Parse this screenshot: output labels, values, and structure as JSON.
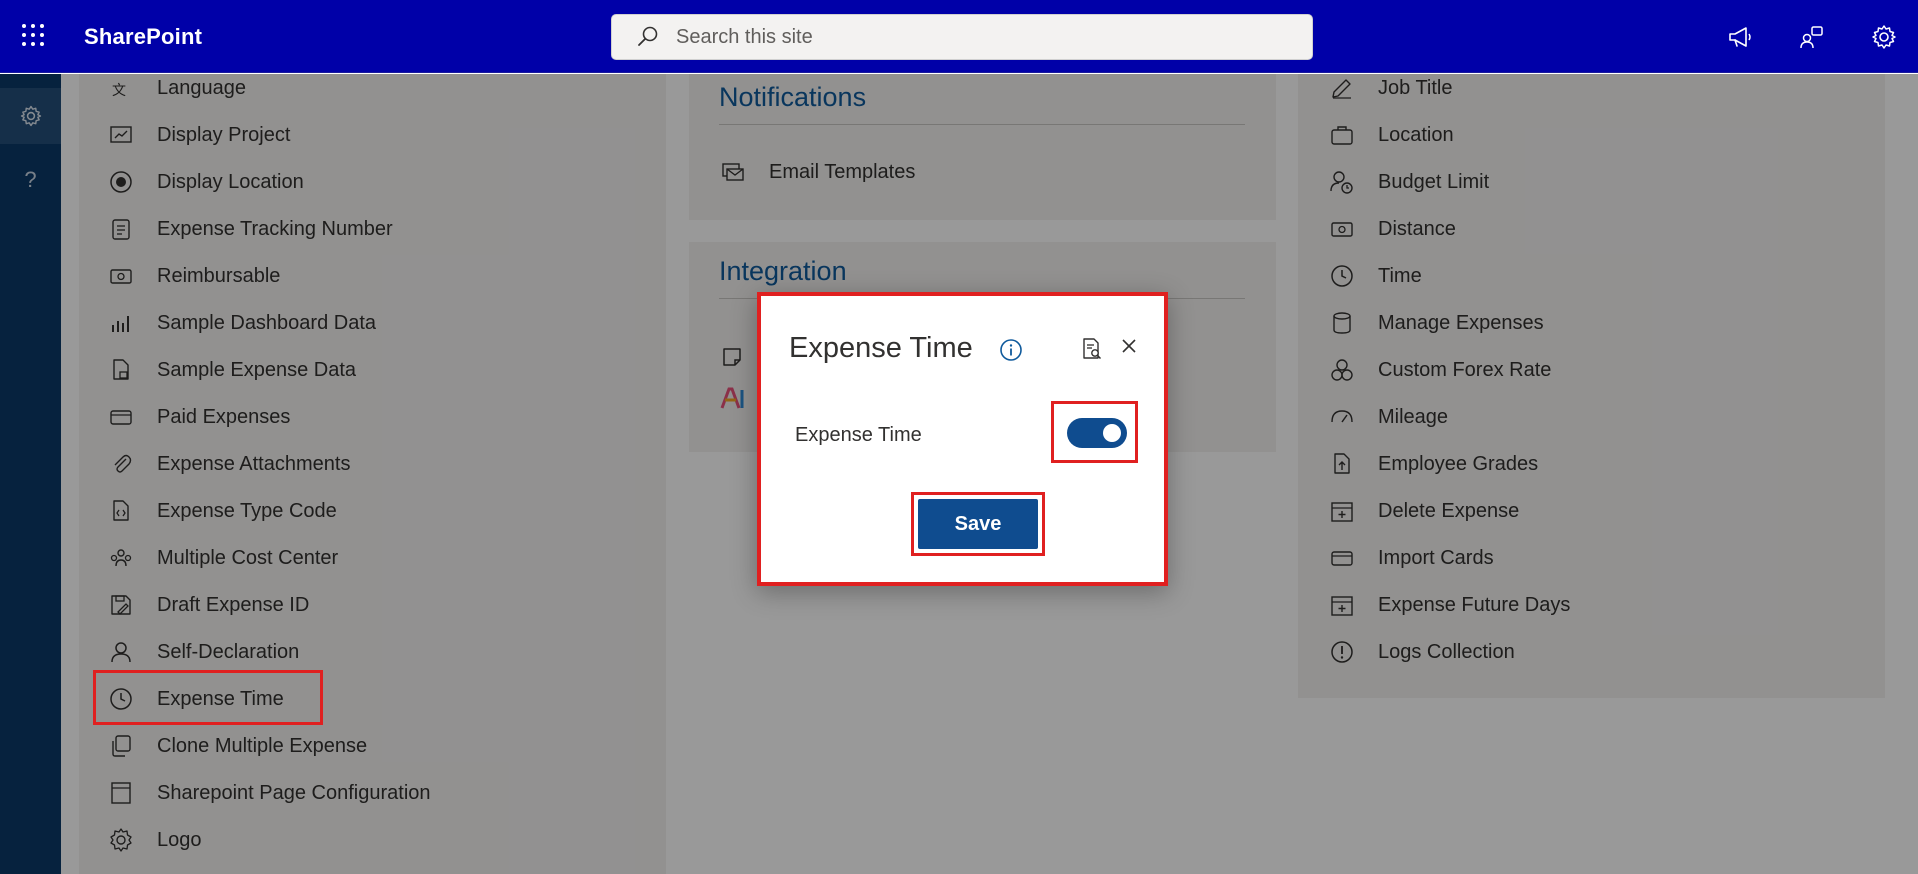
{
  "header": {
    "brand": "SharePoint",
    "search_placeholder": "Search this site",
    "icons": [
      "app-launcher-icon",
      "megaphone-icon",
      "share-people-icon",
      "settings-gear-icon"
    ]
  },
  "rail": {
    "items": [
      {
        "icon": "settings-gear-icon",
        "active": true
      },
      {
        "icon": "help-icon",
        "label": "?"
      }
    ]
  },
  "left_list": {
    "items": [
      {
        "label": "Language",
        "icon": "language-icon"
      },
      {
        "label": "Display Project",
        "icon": "display-project-icon"
      },
      {
        "label": "Display Location",
        "icon": "radio-target-icon"
      },
      {
        "label": "Expense Tracking Number",
        "icon": "clipboard-list-icon"
      },
      {
        "label": "Reimbursable",
        "icon": "money-icon"
      },
      {
        "label": "Sample Dashboard Data",
        "icon": "bar-chart-icon"
      },
      {
        "label": "Sample Expense Data",
        "icon": "document-lock-icon"
      },
      {
        "label": "Paid Expenses",
        "icon": "card-icon"
      },
      {
        "label": "Expense Attachments",
        "icon": "paperclip-icon"
      },
      {
        "label": "Expense Type Code",
        "icon": "code-file-icon"
      },
      {
        "label": "Multiple Cost Center",
        "icon": "people-group-icon"
      },
      {
        "label": "Draft Expense ID",
        "icon": "save-edit-icon"
      },
      {
        "label": "Self-Declaration",
        "icon": "person-icon"
      },
      {
        "label": "Expense Time",
        "icon": "clock-icon",
        "highlighted": true
      },
      {
        "label": "Clone Multiple Expense",
        "icon": "copy-icon"
      },
      {
        "label": "Sharepoint Page Configuration",
        "icon": "page-icon"
      },
      {
        "label": "Logo",
        "icon": "badge-gear-icon"
      }
    ]
  },
  "middle": {
    "notifications_title": "Notifications",
    "notifications_items": [
      {
        "label": "Email Templates",
        "icon": "mail-folder-icon"
      }
    ],
    "integration_title": "Integration"
  },
  "right_list": {
    "items": [
      {
        "label": "Job Title",
        "icon": "edit-icon"
      },
      {
        "label": "Location",
        "icon": "briefcase-icon"
      },
      {
        "label": "Budget Limit",
        "icon": "person-clock-icon"
      },
      {
        "label": "Distance",
        "icon": "money-icon"
      },
      {
        "label": "Time",
        "icon": "clock-icon"
      },
      {
        "label": "Manage Expenses",
        "icon": "database-icon"
      },
      {
        "label": "Custom Forex Rate",
        "icon": "currency-exchange-icon"
      },
      {
        "label": "Mileage",
        "icon": "gauge-icon"
      },
      {
        "label": "Employee Grades",
        "icon": "document-upload-icon"
      },
      {
        "label": "Delete Expense",
        "icon": "calendar-add-icon"
      },
      {
        "label": "Import Cards",
        "icon": "card-icon"
      },
      {
        "label": "Expense Future Days",
        "icon": "calendar-add-icon"
      },
      {
        "label": "Logs Collection",
        "icon": "alert-circle-icon"
      }
    ]
  },
  "dialog": {
    "title": "Expense Time",
    "toggle_label": "Expense Time",
    "toggle_on": true,
    "save_label": "Save",
    "icons": [
      "info-icon",
      "document-search-icon",
      "close-icon"
    ]
  },
  "colors": {
    "header_bg": "#0000a8",
    "rail_bg": "#0b3a68",
    "accent": "#0f4c8f",
    "highlight": "#e02020",
    "title_blue": "#0f5a9c"
  }
}
